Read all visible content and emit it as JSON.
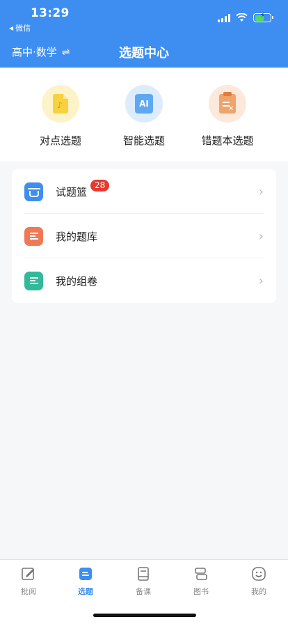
{
  "status_bar": {
    "time": "13:29",
    "back_app": "微信"
  },
  "header": {
    "grade_subject": "高中·数学",
    "swap_icon": "swap-icon",
    "title": "选题中心"
  },
  "quick_actions": [
    {
      "label": "对点选题",
      "icon": "document-note-icon",
      "color": "#f7d23e"
    },
    {
      "label": "智能选题",
      "icon": "ai-icon",
      "color": "#5ea8f3",
      "icon_text": "AI"
    },
    {
      "label": "错题本选题",
      "icon": "clipboard-x-icon",
      "color": "#f0a36b"
    }
  ],
  "list": [
    {
      "label": "试题篮",
      "badge": "28",
      "icon": "basket-icon",
      "color": "#3d8ef0"
    },
    {
      "label": "我的题库",
      "icon": "folder-icon",
      "color": "#ee7a55"
    },
    {
      "label": "我的组卷",
      "icon": "book-list-icon",
      "color": "#33b99a"
    }
  ],
  "tabbar": {
    "active": "选题",
    "tabs": [
      {
        "label": "批阅",
        "icon": "edit-icon"
      },
      {
        "label": "选题",
        "icon": "select-question-icon"
      },
      {
        "label": "备课",
        "icon": "book-icon"
      },
      {
        "label": "图书",
        "icon": "books-icon"
      },
      {
        "label": "我的",
        "icon": "smile-icon"
      }
    ]
  }
}
